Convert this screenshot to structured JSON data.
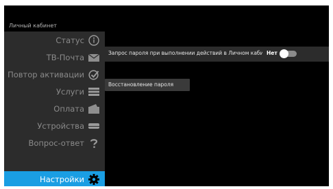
{
  "header": {
    "title": "Личный кабинет"
  },
  "sidebar": {
    "items": [
      {
        "label": "Статус",
        "icon": "info-circle-icon"
      },
      {
        "label": "ТВ-Почта",
        "icon": "envelope-icon"
      },
      {
        "label": "Повтор активации",
        "icon": "check-circle-icon"
      },
      {
        "label": "Услуги",
        "icon": "list-icon"
      },
      {
        "label": "Оплата",
        "icon": "wallet-icon"
      },
      {
        "label": "Устройства",
        "icon": "device-icon"
      },
      {
        "label": "Вопрос-ответ",
        "icon": "question-icon"
      },
      {
        "label": "Настройки",
        "icon": "gear-icon",
        "active": true
      }
    ]
  },
  "settings": {
    "password_prompt_label": "Запрос пароля при выполнении действий в Личном кабинете",
    "password_prompt_value": "Нет",
    "password_prompt_enabled": false,
    "recover_password_label": "Восстановление пароля"
  },
  "colors": {
    "accent": "#1a9ee3",
    "sidebar_bg": "#2c2c2c",
    "background": "#000000",
    "inactive_text": "#8a8a8a"
  }
}
